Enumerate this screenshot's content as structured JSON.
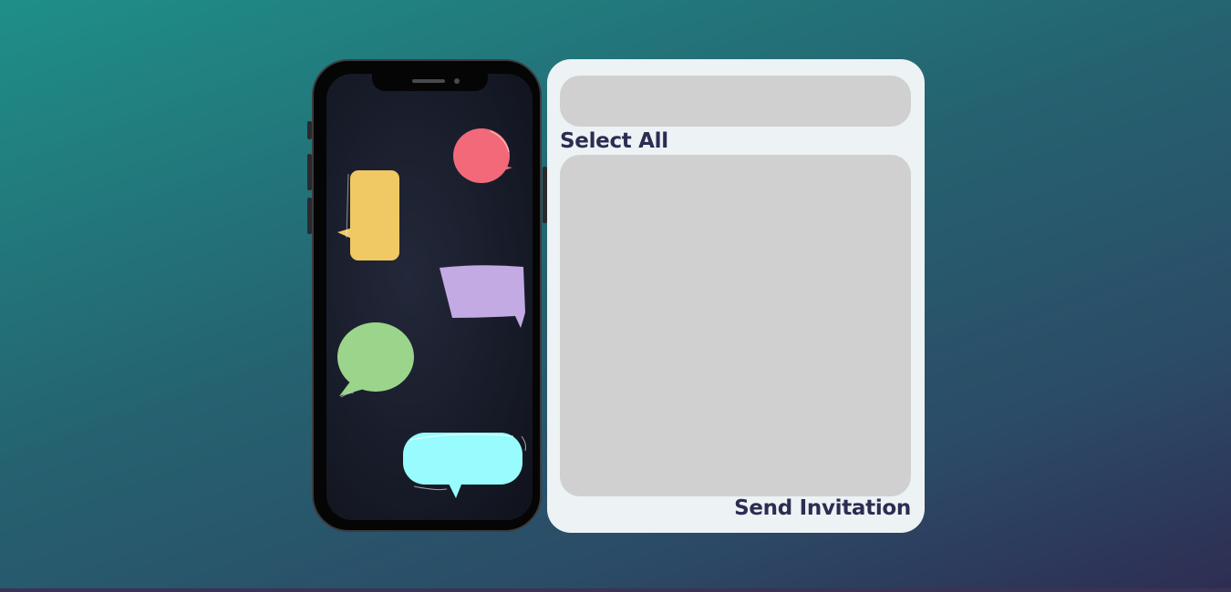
{
  "colors": {
    "background_start": "#1f8f88",
    "background_end": "#2e2d52",
    "card": "#edf2f4",
    "panel": "#d0d0d0",
    "text": "#2b2d52",
    "phone_frame": "#050505",
    "bubble_red": "#f2697a",
    "bubble_yellow": "#f0c965",
    "bubble_purple": "#c3aae3",
    "bubble_green": "#9bd48b",
    "bubble_cyan": "#98fbfd"
  },
  "panel": {
    "search_placeholder": "",
    "select_all_label": "Select All",
    "send_label": "Send Invitation"
  },
  "phone": {
    "icons": [
      "speech-bubble-red",
      "speech-bubble-yellow",
      "speech-bubble-purple",
      "speech-bubble-green",
      "speech-bubble-cyan"
    ]
  }
}
